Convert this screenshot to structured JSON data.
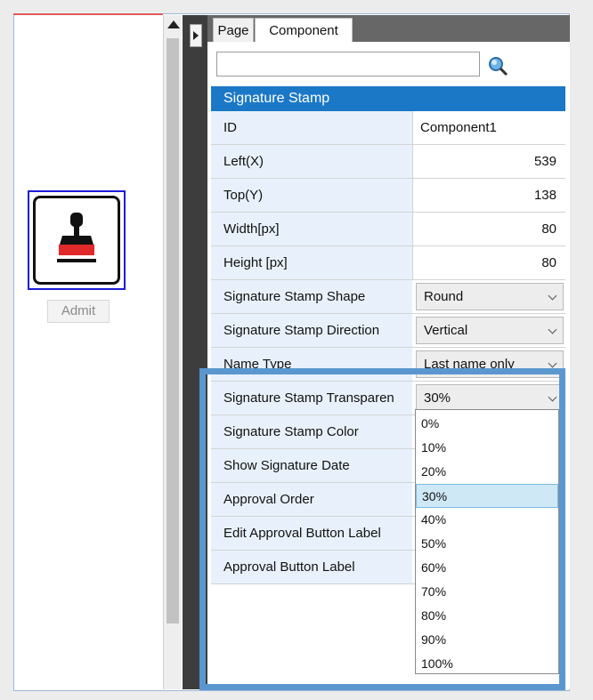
{
  "canvas": {
    "admit_label": "Admit"
  },
  "tabs": {
    "page": "Page",
    "component": "Component"
  },
  "search": {
    "placeholder": ""
  },
  "section_title": "Signature Stamp",
  "props": {
    "id": {
      "label": "ID",
      "value": "Component1"
    },
    "left": {
      "label": "Left(X)",
      "value": "539"
    },
    "top": {
      "label": "Top(Y)",
      "value": "138"
    },
    "width": {
      "label": "Width[px]",
      "value": "80"
    },
    "height": {
      "label": "Height [px]",
      "value": "80"
    },
    "shape": {
      "label": "Signature Stamp Shape",
      "value": "Round"
    },
    "direction": {
      "label": "Signature Stamp Direction",
      "value": "Vertical"
    },
    "name_type": {
      "label": "Name Type",
      "value": "Last name only"
    },
    "transparency": {
      "label": "Signature Stamp Transparen",
      "value": "30%"
    },
    "color": {
      "label": "Signature Stamp Color"
    },
    "show_date": {
      "label": "Show Signature Date"
    },
    "approval_order": {
      "label": "Approval Order"
    },
    "edit_label": {
      "label": "Edit Approval Button Label"
    },
    "approval_label": {
      "label": "Approval Button Label"
    }
  },
  "dropdown": {
    "options": [
      "0%",
      "10%",
      "20%",
      "30%",
      "40%",
      "50%",
      "60%",
      "70%",
      "80%",
      "90%",
      "100%"
    ],
    "selected": "30%"
  },
  "colors": {
    "header_blue": "#1b78c7",
    "highlight_blue": "#5b97cf",
    "selection_border": "#1c1cd8",
    "stamp_red": "#e02a2a"
  }
}
